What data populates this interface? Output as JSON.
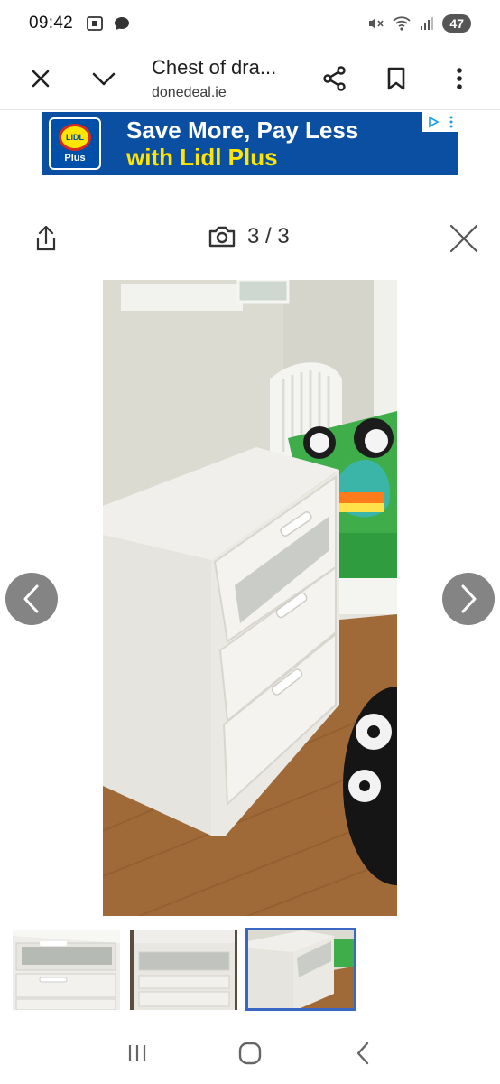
{
  "status_bar": {
    "time": "09:42",
    "battery": "47"
  },
  "toolbar": {
    "title": "Chest of dra...",
    "domain": "donedeal.ie"
  },
  "ad": {
    "logo_text": "LIDL",
    "logo_sub": "Plus",
    "line1": "Save More, Pay Less",
    "line2": "with Lidl Plus",
    "colors": {
      "background": "#0b4fa2",
      "accent": "#ffe500"
    }
  },
  "viewer": {
    "counter": "3 / 3"
  },
  "icons": {
    "close": "close-icon",
    "chevron": "chevron-down-icon",
    "share": "share-icon",
    "bookmark": "bookmark-icon",
    "menu": "more-vert-icon",
    "camera": "camera-icon"
  }
}
